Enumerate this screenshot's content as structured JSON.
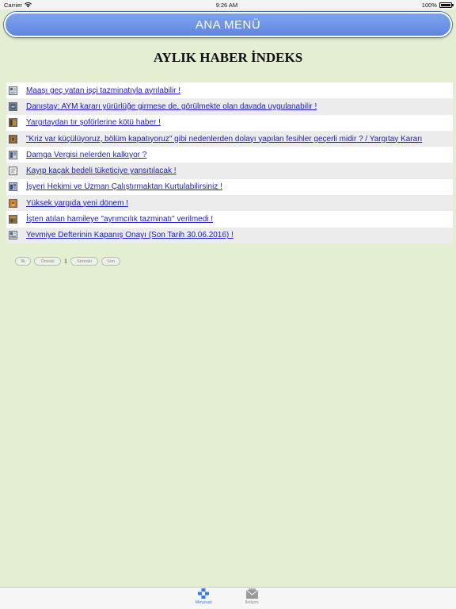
{
  "status_bar": {
    "carrier": "Carrier",
    "time": "9:26 AM",
    "battery": "100%"
  },
  "header": {
    "title": "ANA MENÜ"
  },
  "page": {
    "title": "AYLIK HABER İNDEKS"
  },
  "news": [
    {
      "title": "Maaşı geç yatan işçi tazminatıyla ayrılabilir !",
      "thumb_icon": "news-thumbnail-icon"
    },
    {
      "title": "Danıştay: AYM kararı yürürlüğe girmese de, görülmekte olan davada uygulanabilir !",
      "thumb_icon": "news-thumbnail-icon"
    },
    {
      "title": "Yargıtaydan tır şoförlerine kötü haber !",
      "thumb_icon": "news-thumbnail-icon"
    },
    {
      "title": "\"Kriz var küçülüyoruz, bölüm kapatıyoruz\" gibi nedenlerden dolayı yapılan fesihler geçerli midir ? / Yargıtay Kararı",
      "thumb_icon": "news-thumbnail-icon"
    },
    {
      "title": "Damga Vergisi nelerden kalkıyor ?",
      "thumb_icon": "news-thumbnail-icon"
    },
    {
      "title": "Kayıp kaçak bedeli tüketiciye yansıtılacak !",
      "thumb_icon": "news-thumbnail-icon"
    },
    {
      "title": "İşyeri Hekimi ve Uzman Çalıştırmaktan Kurtulabilirsiniz !",
      "thumb_icon": "news-thumbnail-icon"
    },
    {
      "title": "Yüksek yargıda yeni dönem !",
      "thumb_icon": "news-thumbnail-icon"
    },
    {
      "title": "İşten atılan hamileye \"ayrımcılık tazminatı\" verilmedi !",
      "thumb_icon": "news-thumbnail-icon"
    },
    {
      "title": "Yevmiye Defterinin Kapanış Onayı (Son Tarih 30.06.2016) !",
      "thumb_icon": "news-thumbnail-icon"
    }
  ],
  "pager": {
    "first": "İlk",
    "prev": "Önceki",
    "current": "1",
    "next": "Sonraki",
    "last": "Son"
  },
  "tabs": [
    {
      "label": "Mevzuat",
      "icon": "grid-blocks-icon",
      "active": true
    },
    {
      "label": "İletişim",
      "icon": "envelope-icon",
      "active": false
    }
  ],
  "colors": {
    "background": "#e4eed1",
    "header": "#6b8fe6",
    "link": "#1a1acc",
    "tab_active": "#3478f6"
  }
}
